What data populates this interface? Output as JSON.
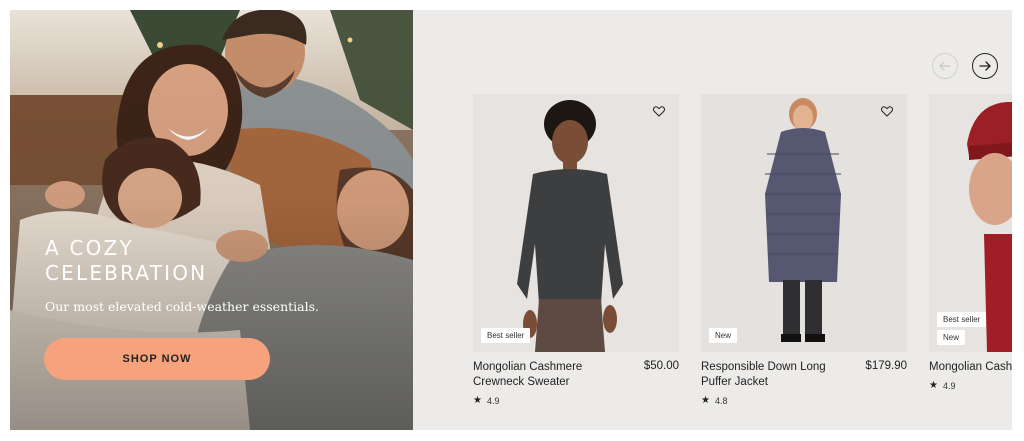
{
  "hero": {
    "title_line1": "A COZY",
    "title_line2": "CELEBRATION",
    "subtitle": "Our most elevated cold-weather essentials.",
    "cta_label": "SHOP NOW"
  },
  "carousel": {
    "prev_icon": "arrow-left-icon",
    "next_icon": "arrow-right-icon",
    "products": [
      {
        "name": "Mongolian Cashmere Crewneck Sweater",
        "price": "$50.00",
        "rating": "4.9",
        "badges": [
          "Best seller"
        ]
      },
      {
        "name": "Responsible Down Long Puffer Jacket",
        "price": "$179.90",
        "rating": "4.8",
        "badges": [
          "New"
        ]
      },
      {
        "name": "Mongolian Cashmere Beanie",
        "price": "",
        "rating": "4.9",
        "badges": [
          "Best seller",
          "New"
        ]
      }
    ]
  },
  "colors": {
    "cta_background": "#f6a27c",
    "panel_background": "#ecebe9"
  }
}
